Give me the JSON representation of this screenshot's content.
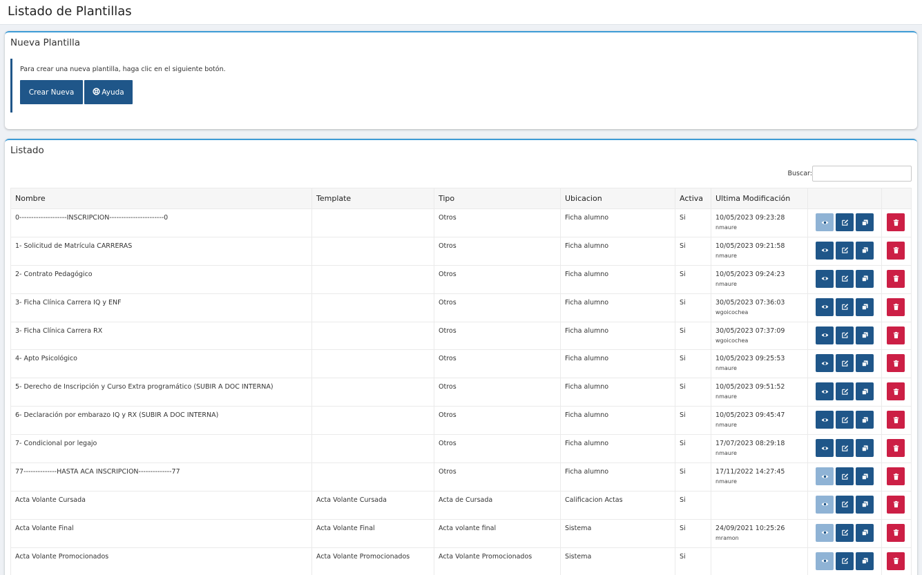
{
  "page": {
    "title": "Listado de Plantillas"
  },
  "new_template": {
    "title": "Nueva Plantilla",
    "instructions": "Para crear una nueva plantilla, haga clic en el siguiente botón.",
    "create_label": "Crear Nueva",
    "help_label": "Ayuda"
  },
  "listing": {
    "title": "Listado",
    "search_label": "Buscar:",
    "search_value": "",
    "columns": [
      "Nombre",
      "Template",
      "Tipo",
      "Ubicacion",
      "Activa",
      "Ultima Modificación",
      "",
      ""
    ],
    "rows": [
      {
        "nombre": "0--------------------INSCRIPCION-----------------------0",
        "template": "",
        "tipo": "Otros",
        "ubicacion": "Ficha alumno",
        "activa": "Si",
        "fecha": "10/05/2023 09:23:28",
        "usuario": "nmaure",
        "view_state": "light"
      },
      {
        "nombre": "1- Solicitud de Matrícula CARRERAS",
        "template": "",
        "tipo": "Otros",
        "ubicacion": "Ficha alumno",
        "activa": "Si",
        "fecha": "10/05/2023 09:21:58",
        "usuario": "nmaure",
        "view_state": "dark"
      },
      {
        "nombre": "2- Contrato Pedagógico",
        "template": "",
        "tipo": "Otros",
        "ubicacion": "Ficha alumno",
        "activa": "Si",
        "fecha": "10/05/2023 09:24:23",
        "usuario": "nmaure",
        "view_state": "dark"
      },
      {
        "nombre": "3- Ficha Clínica Carrera IQ y ENF",
        "template": "",
        "tipo": "Otros",
        "ubicacion": "Ficha alumno",
        "activa": "Si",
        "fecha": "30/05/2023 07:36:03",
        "usuario": "wgoicochea",
        "view_state": "dark"
      },
      {
        "nombre": "3- Ficha Clínica Carrera RX",
        "template": "",
        "tipo": "Otros",
        "ubicacion": "Ficha alumno",
        "activa": "Si",
        "fecha": "30/05/2023 07:37:09",
        "usuario": "wgoicochea",
        "view_state": "dark"
      },
      {
        "nombre": "4- Apto Psicológico",
        "template": "",
        "tipo": "Otros",
        "ubicacion": "Ficha alumno",
        "activa": "Si",
        "fecha": "10/05/2023 09:25:53",
        "usuario": "nmaure",
        "view_state": "dark"
      },
      {
        "nombre": "5- Derecho de Inscripción y Curso Extra programático (SUBIR A DOC INTERNA)",
        "template": "",
        "tipo": "Otros",
        "ubicacion": "Ficha alumno",
        "activa": "Si",
        "fecha": "10/05/2023 09:51:52",
        "usuario": "nmaure",
        "view_state": "dark"
      },
      {
        "nombre": "6- Declaración por embarazo IQ y RX (SUBIR A DOC INTERNA)",
        "template": "",
        "tipo": "Otros",
        "ubicacion": "Ficha alumno",
        "activa": "Si",
        "fecha": "10/05/2023 09:45:47",
        "usuario": "nmaure",
        "view_state": "dark"
      },
      {
        "nombre": "7- Condicional por legajo",
        "template": "",
        "tipo": "Otros",
        "ubicacion": "Ficha alumno",
        "activa": "Si",
        "fecha": "17/07/2023 08:29:18",
        "usuario": "nmaure",
        "view_state": "dark"
      },
      {
        "nombre": "77--------------HASTA ACA INSCRIPCION--------------77",
        "template": "",
        "tipo": "Otros",
        "ubicacion": "Ficha alumno",
        "activa": "Si",
        "fecha": "17/11/2022 14:27:45",
        "usuario": "nmaure",
        "view_state": "light"
      },
      {
        "nombre": "Acta Volante Cursada",
        "template": "Acta Volante Cursada",
        "tipo": "Acta de Cursada",
        "ubicacion": "Calificacion Actas",
        "activa": "Si",
        "fecha": "",
        "usuario": "",
        "view_state": "light"
      },
      {
        "nombre": "Acta Volante Final",
        "template": "Acta Volante Final",
        "tipo": "Acta volante final",
        "ubicacion": "Sistema",
        "activa": "Si",
        "fecha": "24/09/2021 10:25:26",
        "usuario": "mramon",
        "view_state": "light"
      },
      {
        "nombre": "Acta Volante Promocionados",
        "template": "Acta Volante Promocionados",
        "tipo": "Acta Volante Promocionados",
        "ubicacion": "Sistema",
        "activa": "Si",
        "fecha": "",
        "usuario": "",
        "view_state": "light"
      }
    ]
  },
  "icons": {
    "view": "eye-icon",
    "edit": "edit-icon",
    "copy": "copy-icon",
    "delete": "trash-icon",
    "help": "lifebuoy-icon"
  },
  "colors": {
    "primary": "#1f5689",
    "primary_light": "#8fb3d5",
    "danger": "#cc1f45",
    "accent_border": "#3c9bd6"
  }
}
